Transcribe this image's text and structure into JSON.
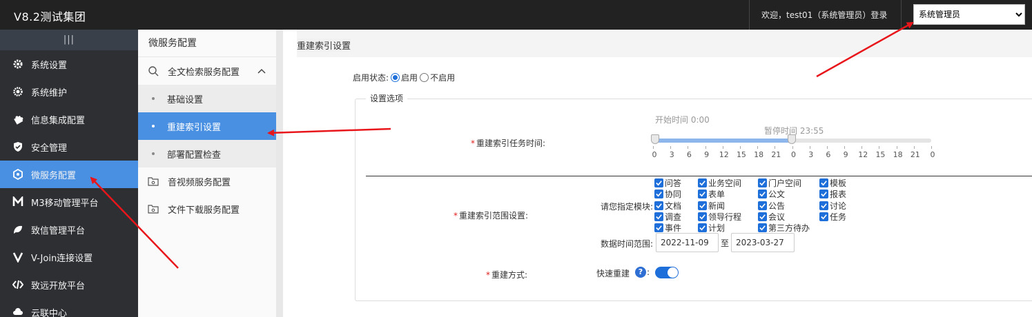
{
  "topbar": {
    "brand": "V8.2测试集团",
    "welcome": "欢迎，test01（系统管理员）登录",
    "role_selected": "系统管理员"
  },
  "leftnav": {
    "collapse_glyph": "|||",
    "items": [
      {
        "label": "系统设置",
        "icon": "gear-icon"
      },
      {
        "label": "系统维护",
        "icon": "cog-icon"
      },
      {
        "label": "信息集成配置",
        "icon": "puzzle-icon"
      },
      {
        "label": "安全管理",
        "icon": "shield-icon"
      },
      {
        "label": "微服务配置",
        "icon": "hexagon-icon",
        "active": true
      },
      {
        "label": "M3移动管理平台",
        "icon": "m-logo-icon"
      },
      {
        "label": "致信管理平台",
        "icon": "leaf-icon"
      },
      {
        "label": "V-Join连接设置",
        "icon": "v-logo-icon"
      },
      {
        "label": "致远开放平台",
        "icon": "code-icon"
      },
      {
        "label": "云联中心",
        "icon": "cloud-icon"
      }
    ]
  },
  "subnav": {
    "title": "微服务配置",
    "group_search": "全文检索服务配置",
    "subs": [
      "基础设置",
      "重建索引设置",
      "部署配置检查"
    ],
    "group_media": "音视频服务配置",
    "group_download": "文件下载服务配置"
  },
  "main": {
    "title": "重建索引设置",
    "status_label": "启用状态:",
    "status_on": "启用",
    "status_off": "不启用",
    "section_legend": "设置选项",
    "task_time_label": "重建索引任务时间:",
    "start_caption": "开始时间 0:00",
    "pause_caption": "暂停时间 23:55",
    "slider": {
      "start_hours": 0,
      "pause_hours": 23.92,
      "tick_labels": [
        "0",
        "3",
        "6",
        "9",
        "12",
        "15",
        "18",
        "21",
        "0",
        "3",
        "6",
        "9",
        "12",
        "15",
        "18",
        "21",
        "0"
      ]
    },
    "scope_label": "重建索引范围设置:",
    "module_label": "请您指定模块:",
    "modules": [
      [
        "问答",
        "业务空间",
        "门户空间",
        "模板"
      ],
      [
        "协同",
        "表单",
        "公文",
        "报表"
      ],
      [
        "文档",
        "新闻",
        "公告",
        "讨论"
      ],
      [
        "调查",
        "领导行程",
        "会议",
        "任务"
      ],
      [
        "事件",
        "计划",
        "第三方待办"
      ]
    ],
    "date_label": "数据时间范围:",
    "date_from": "2022-11-09",
    "date_sep": "至",
    "date_to": "2023-03-27",
    "rebuild_label": "重建方式:",
    "rebuild_mode": "快速重建",
    "help_glyph": "?",
    "colon": ":"
  },
  "colors": {
    "accent": "#4a90e2",
    "topbar": "#222222",
    "sidebar": "#2d2f33",
    "annotation_arrow": "#e8161b"
  }
}
